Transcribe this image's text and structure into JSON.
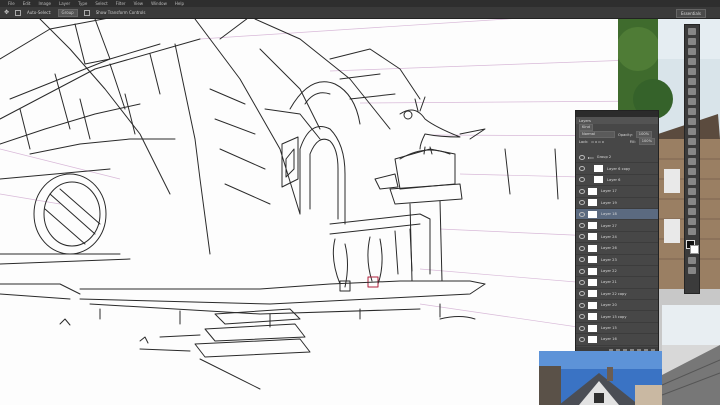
{
  "menu": [
    "File",
    "Edit",
    "Image",
    "Layer",
    "Type",
    "Select",
    "Filter",
    "View",
    "Window",
    "Help"
  ],
  "options": {
    "auto_select_label": "Auto-Select:",
    "auto_select_value": "Group",
    "transform_label": "Show Transform Controls"
  },
  "workspace": "Essentials",
  "layers_panel": {
    "tab": "Layers",
    "filter": "Kind",
    "blend_mode": "Normal",
    "opacity_label": "Opacity:",
    "opacity_value": "100%",
    "lock_label": "Lock:",
    "fill_label": "Fill:",
    "fill_value": "100%",
    "layers": [
      {
        "name": "Group 2"
      },
      {
        "name": "Layer 6 copy"
      },
      {
        "name": "Layer 6"
      },
      {
        "name": "Layer 17"
      },
      {
        "name": "Layer 19"
      },
      {
        "name": "Layer 18"
      },
      {
        "name": "Layer 27"
      },
      {
        "name": "Layer 24"
      },
      {
        "name": "Layer 26"
      },
      {
        "name": "Layer 23"
      },
      {
        "name": "Layer 22"
      },
      {
        "name": "Layer 21"
      },
      {
        "name": "Layer 22 copy"
      },
      {
        "name": "Layer 20"
      },
      {
        "name": "Layer 15 copy"
      },
      {
        "name": "Layer 15"
      },
      {
        "name": "Layer 16"
      }
    ]
  },
  "colors": {
    "ui_dark": "#2e2e2e",
    "panel": "#474747",
    "selected_layer": "#5b6a80",
    "sketch_line": "#2a2a2a",
    "guide": "#c9a6c9"
  }
}
